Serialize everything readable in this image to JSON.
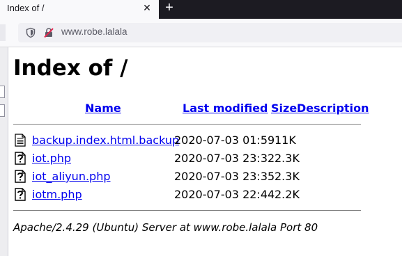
{
  "browser": {
    "tab_title": "Index of /",
    "tab_close": "✕",
    "new_tab": "+",
    "url": "www.robe.lalala"
  },
  "page": {
    "heading": "Index of /",
    "columns": {
      "name": "Name",
      "last_modified": "Last modified",
      "size": "Size",
      "description": "Description"
    },
    "files": [
      {
        "name": "backup.index.html.backup",
        "modified": "2020-07-03 01:59",
        "size": "11K",
        "icon": "text-file-icon"
      },
      {
        "name": "iot.php",
        "modified": "2020-07-03 23:32",
        "size": "2.3K",
        "icon": "unknown-file-icon"
      },
      {
        "name": "iot_aliyun.php",
        "modified": "2020-07-03 23:35",
        "size": "2.3K",
        "icon": "unknown-file-icon"
      },
      {
        "name": "iotm.php",
        "modified": "2020-07-03 22:44",
        "size": "2.2K",
        "icon": "unknown-file-icon"
      }
    ],
    "footer": "Apache/2.4.29 (Ubuntu) Server at www.robe.lalala Port 80"
  }
}
